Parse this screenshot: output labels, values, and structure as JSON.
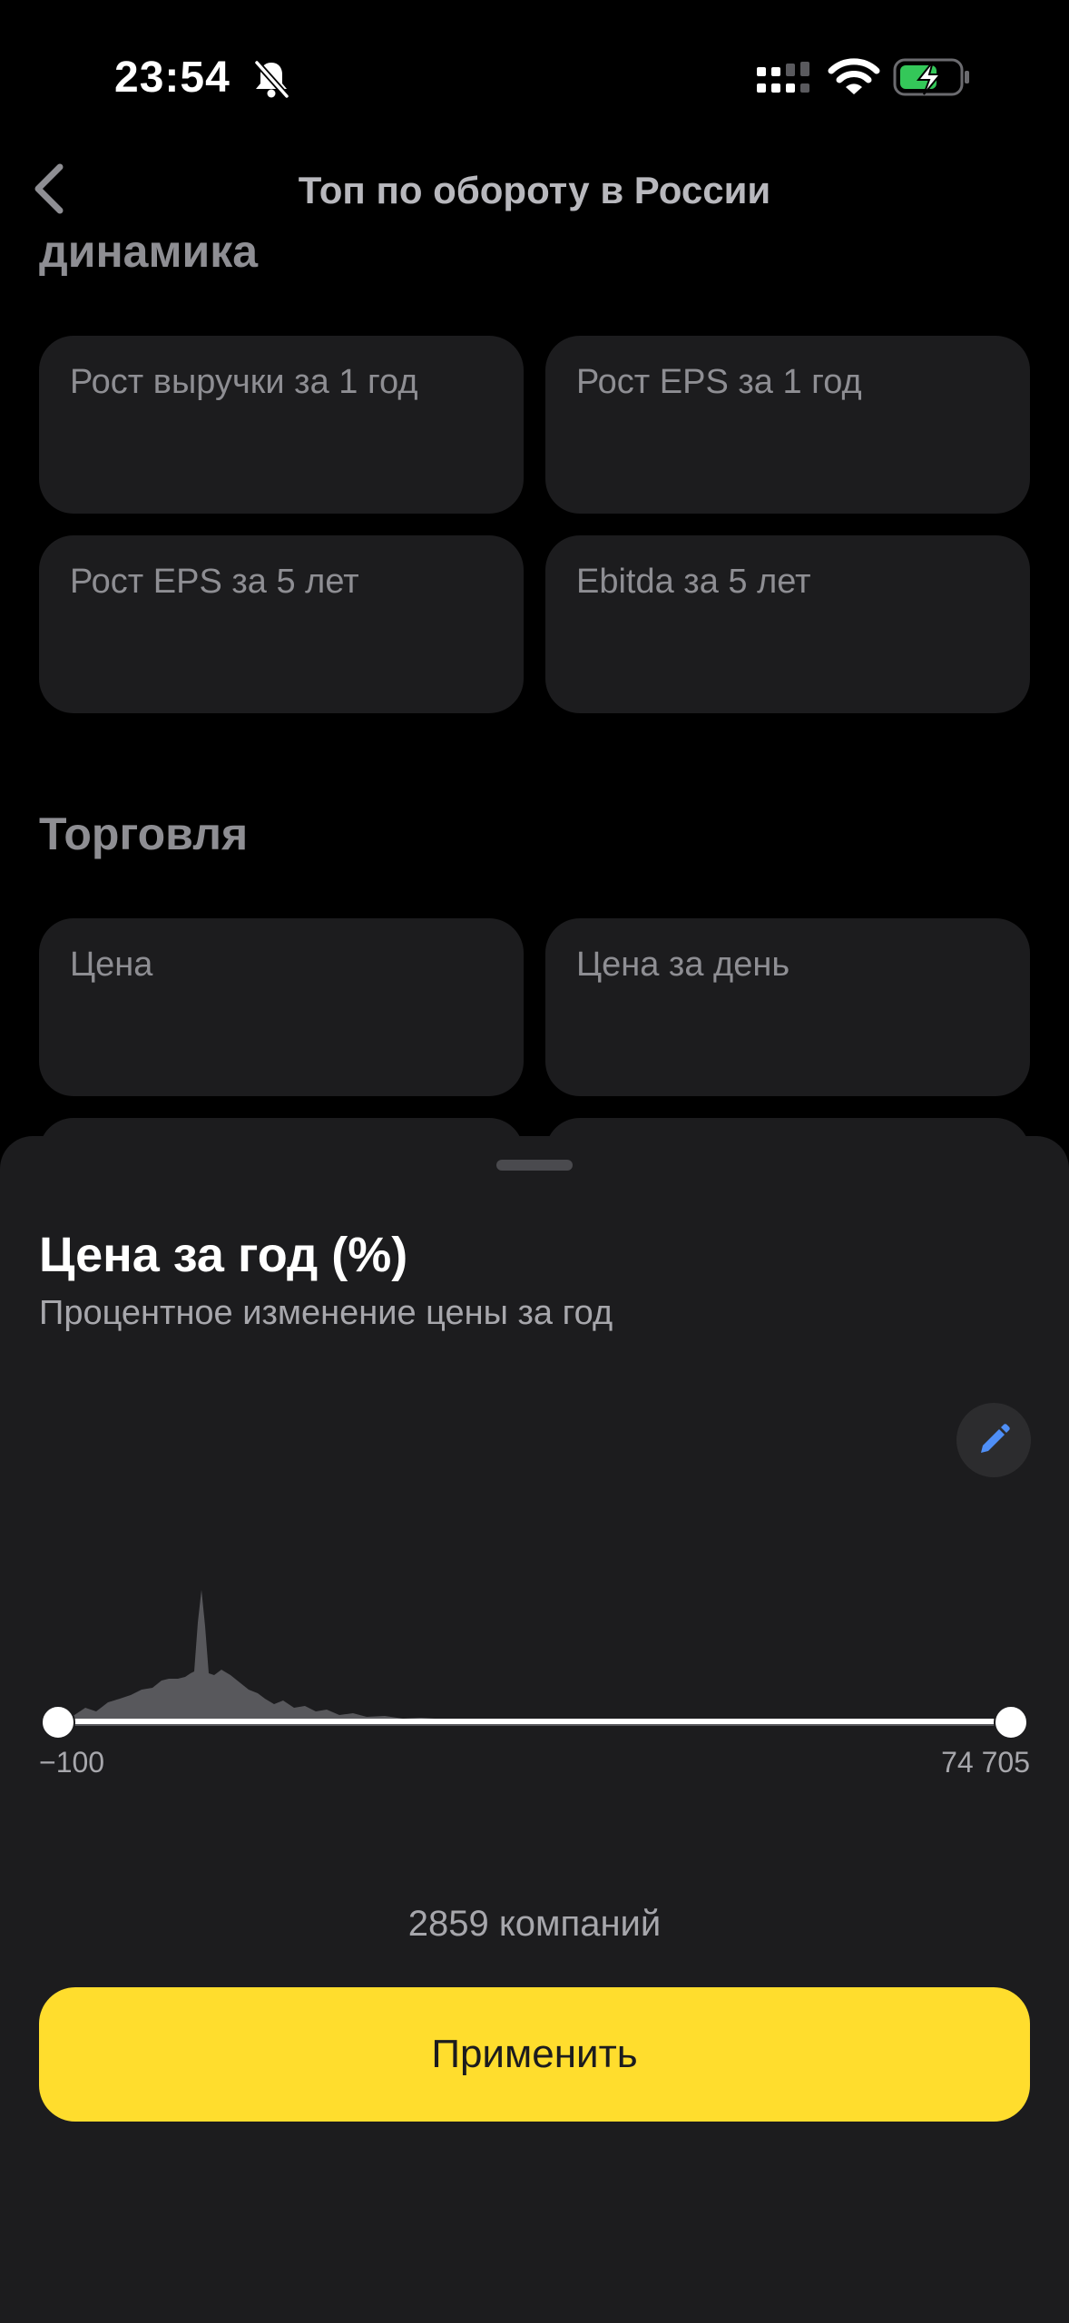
{
  "status_bar": {
    "time": "23:54",
    "icons": [
      "bell-off-icon",
      "signal-icon",
      "wifi-icon",
      "battery-charging-icon"
    ]
  },
  "header": {
    "back_icon": "chevron-left-icon",
    "title": "Топ по обороту в России"
  },
  "background": {
    "section_dynamics": "динамика",
    "dynamics_cards": [
      "Рост выручки за 1 год",
      "Рост EPS за 1 год",
      "Рост EPS за 5 лет",
      "Ebitda за 5 лет"
    ],
    "section_trading": "Торговля",
    "trading_cards": [
      "Цена",
      "Цена за день"
    ]
  },
  "sheet": {
    "title": "Цена за год (%)",
    "subtitle": "Процентное изменение цены за год",
    "edit_icon": "pencil-icon",
    "range": {
      "min_label": "−100",
      "max_label": "74 705",
      "selected_min_fraction": 0.0,
      "selected_max_fraction": 1.0
    },
    "companies_count": "2859 компаний",
    "apply_label": "Применить"
  },
  "colors": {
    "accent_yellow": "#ffdd2d",
    "sheet_background": "#1c1c1e",
    "card_background": "#1c1c1e",
    "muted_text": "#8e8e93",
    "edit_icon_blue": "#4f8ff7",
    "histogram_fill": "#58585c",
    "battery_green": "#34c759"
  }
}
